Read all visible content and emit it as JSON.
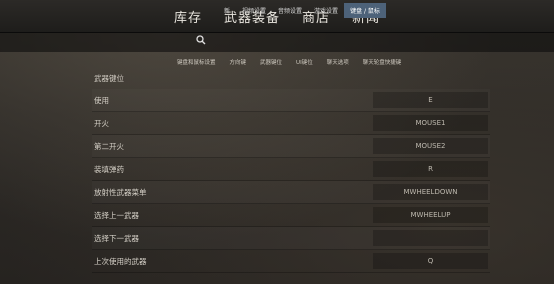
{
  "top_nav": [
    "库存",
    "武器装备",
    "商店",
    "新闻"
  ],
  "sub_nav": [
    {
      "label": "新",
      "active": false
    },
    {
      "label": "视频设置",
      "active": false
    },
    {
      "label": "音频设置",
      "active": false
    },
    {
      "label": "游戏设置",
      "active": false
    },
    {
      "label": "键盘 / 鼠标",
      "active": true
    }
  ],
  "tabs": [
    "键盘和鼠标设置",
    "方向键",
    "武器键位",
    "UI键位",
    "聊天选项",
    "聊天轮盘快捷键"
  ],
  "section_title": "武器键位",
  "bindings": [
    {
      "label": "使用",
      "key": "E"
    },
    {
      "label": "开火",
      "key": "MOUSE1"
    },
    {
      "label": "第二开火",
      "key": "MOUSE2"
    },
    {
      "label": "装填弹药",
      "key": "R"
    },
    {
      "label": "放射性武器菜单",
      "key": "MWHEELDOWN"
    },
    {
      "label": "选择上一武器",
      "key": "MWHEELUP"
    },
    {
      "label": "选择下一武器",
      "key": ""
    },
    {
      "label": "上次使用的武器",
      "key": "Q"
    }
  ],
  "colors": {
    "active_tab_bg": "#4d6279",
    "topbar": "#1e1d1b"
  }
}
